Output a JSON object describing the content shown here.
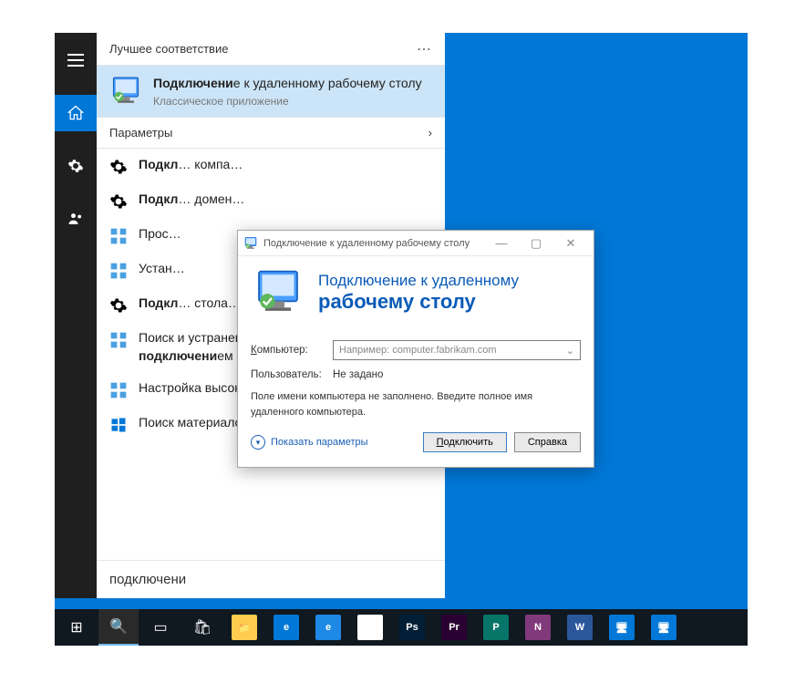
{
  "search": {
    "header": "Лучшее соответствие",
    "best_match": {
      "title_html": "<strong>Подключени</strong>е к удаленному рабочему столу",
      "subtitle": "Классическое приложение"
    },
    "section_params": "Параметры",
    "results": [
      "<strong>Подкл</strong>… компа…",
      "<strong>Подкл</strong>… домен…",
      "Прос…",
      "Устан…",
      "<strong>Подкл</strong>… стола…",
      "Поиск и устранение проблем с сетью и <strong>подключени</strong>ем",
      "Настройка высокоскоростного <strong>подключени</strong>я",
      "Поиск материалов"
    ],
    "query": "подключени"
  },
  "rdc": {
    "title": "Подключение к удаленному рабочему столу",
    "banner_line1": "Подключение к удаленному",
    "banner_line2": "рабочему столу",
    "label_computer": "Компьютер:",
    "placeholder_computer": "Например: computer.fabrikam.com",
    "label_user": "Пользователь:",
    "value_user": "Не задано",
    "hint": "Поле имени компьютера не заполнено. Введите полное имя удаленного компьютера.",
    "show_params": "Показать параметры",
    "btn_connect": "Подключить",
    "btn_help": "Справка"
  },
  "taskbar": {
    "apps": [
      {
        "name": "start",
        "bg": "transparent",
        "glyph": "⊞"
      },
      {
        "name": "search",
        "bg": "transparent",
        "glyph": "🔍"
      },
      {
        "name": "taskview",
        "bg": "transparent",
        "glyph": "▭"
      },
      {
        "name": "store",
        "bg": "transparent",
        "glyph": "🛍"
      },
      {
        "name": "explorer",
        "bg": "#ffcc4d",
        "glyph": "📁"
      },
      {
        "name": "edge",
        "bg": "#0178d7",
        "glyph": "e"
      },
      {
        "name": "ie",
        "bg": "#1e88e5",
        "glyph": "e"
      },
      {
        "name": "chrome",
        "bg": "#fff",
        "glyph": "◉"
      },
      {
        "name": "photoshop",
        "bg": "#001e36",
        "glyph": "Ps"
      },
      {
        "name": "premiere",
        "bg": "#2a0033",
        "glyph": "Pr"
      },
      {
        "name": "publisher",
        "bg": "#077568",
        "glyph": "P"
      },
      {
        "name": "onenote",
        "bg": "#80397b",
        "glyph": "N"
      },
      {
        "name": "word",
        "bg": "#2b579a",
        "glyph": "W"
      },
      {
        "name": "app1",
        "bg": "#0178d7",
        "glyph": "🖥"
      },
      {
        "name": "rdc",
        "bg": "#0178d7",
        "glyph": "🖥"
      }
    ]
  }
}
